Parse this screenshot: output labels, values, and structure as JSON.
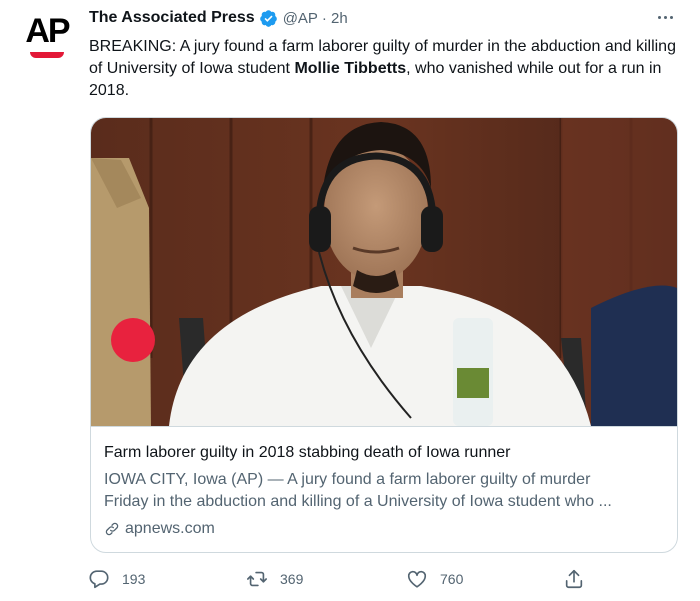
{
  "tweet": {
    "author": {
      "name": "The Associated Press",
      "logo_text": "AP",
      "verified": true,
      "handle_time": "@AP · 2h"
    },
    "text": {
      "before": "BREAKING: A jury found a farm laborer guilty of murder in the abduction and killing of University of Iowa student ",
      "highlight": "Mollie Tibbetts",
      "after": ", who vanished while out for a run in 2018."
    },
    "card": {
      "title": "Farm laborer guilty in 2018 stabbing death of Iowa runner",
      "description_line1": "IOWA CITY, Iowa (AP) — A jury found a farm laborer guilty of murder",
      "description_line2": "Friday in the abduction and killing of a University of Iowa student who ...",
      "domain": "apnews.com"
    },
    "actions": {
      "replies": "193",
      "retweets": "369",
      "likes": "760"
    },
    "colors": {
      "ap_red": "#e31837",
      "verified_blue": "#1d9bf0",
      "secondary_text": "#536471",
      "border": "#cfd9de"
    },
    "icons": {
      "more": "more-dots-icon",
      "reply": "reply-bubble-icon",
      "retweet": "retweet-icon",
      "like": "heart-icon",
      "share": "share-icon",
      "link": "link-icon",
      "verified": "verified-badge-icon"
    }
  }
}
